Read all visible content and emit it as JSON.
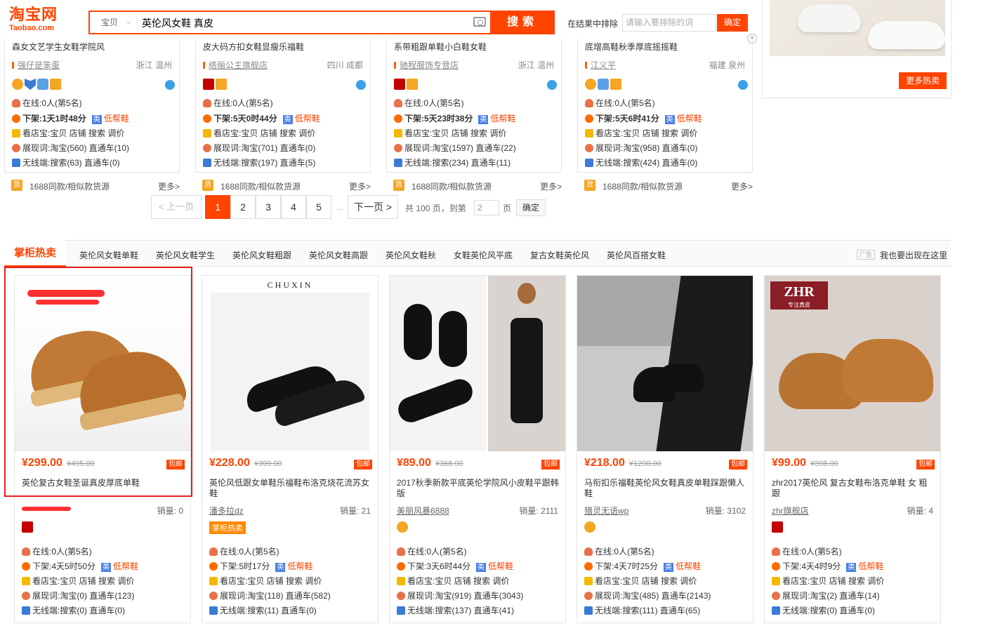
{
  "header": {
    "logo_cn": "淘宝网",
    "logo_en": "Taobao.com",
    "scope": "宝贝",
    "query": "英伦风女鞋 真皮",
    "search_btn": "搜索",
    "exclude_label": "在结果中排除",
    "exclude_placeholder": "请输入要排除的词",
    "exclude_btn": "确定",
    "close": "×"
  },
  "right_panel": {
    "more_btn": "更多热卖"
  },
  "top_cards": [
    {
      "title": "森女文艺学生女鞋学院风",
      "shop": "强仔是笨蛋",
      "loc": "浙江 温州",
      "online": "在线:0人(第5名)",
      "xiajia": "下架:1天1时48分",
      "lei": "类",
      "leilabel": "低帮鞋",
      "kdb": "看店宝:宝贝 店铺 搜索 调价",
      "zxc": "展现词:淘宝(560) 直通车(10)",
      "wx": "无线端:搜索(63) 直通车(0)",
      "r1688": "1688同款/相似款货源",
      "more": "更多>"
    },
    {
      "title": "皮大码方扣女鞋显瘦乐福鞋",
      "shop": "络俪公主旗舰店",
      "loc": "四川 成都",
      "online": "在线:0人(第5名)",
      "xiajia": "下架:5天0时44分",
      "lei": "类",
      "leilabel": "低帮鞋",
      "kdb": "看店宝:宝贝 店铺 搜索 调价",
      "zxc": "展现词:淘宝(701) 直通车(0)",
      "wx": "无线端:搜索(197) 直通车(5)",
      "r1688": "1688同款/相似款货源",
      "more": "更多>"
    },
    {
      "title": "系带粗跟单鞋小白鞋女鞋",
      "shop": "驰程服饰专营店",
      "loc": "浙江 温州",
      "online": "在线:0人(第5名)",
      "xiajia": "下架:5天23时38分",
      "lei": "类",
      "leilabel": "低帮鞋",
      "kdb": "看店宝:宝贝 店铺 搜索 调价",
      "zxc": "展现词:淘宝(1597) 直通车(22)",
      "wx": "无线端:搜索(234) 直通车(11)",
      "r1688": "1688同款/相似款货源",
      "more": "更多>"
    },
    {
      "title": "底增高鞋秋季厚底摇摇鞋",
      "shop": "江义平",
      "loc": "福建 泉州",
      "online": "在线:0人(第5名)",
      "xiajia": "下架:5天6时41分",
      "lei": "类",
      "leilabel": "低帮鞋",
      "kdb": "看店宝:宝贝 店铺 搜索 调价",
      "zxc": "展现词:淘宝(958) 直通车(0)",
      "wx": "无线端:搜索(424) 直通车(0)",
      "r1688": "1688同款/相似款货源",
      "more": "更多>"
    }
  ],
  "pager": {
    "prev": "< 上一页",
    "pages": [
      "1",
      "2",
      "3",
      "4",
      "5"
    ],
    "ellipsis": "...",
    "next": "下一页 >",
    "total": "共 100 页，到第",
    "goto": "2",
    "ye": "页",
    "ok": "确定"
  },
  "hot": {
    "title": "掌柜热卖",
    "links": [
      "英伦风女鞋单鞋",
      "英伦风女鞋学生",
      "英伦风女鞋粗跟",
      "英伦风女鞋高跟",
      "英伦风女鞋秋",
      "女鞋英伦风平底",
      "复古女鞋英伦风",
      "英伦风百搭女鞋"
    ],
    "ad": "广告",
    "ad_text": "我也要出现在这里"
  },
  "products": [
    {
      "price": "¥299.00",
      "oprice": "¥495.00",
      "baoyou": "包邮",
      "title": "英伦复古女鞋圣诞真皮厚底单鞋",
      "shop": "",
      "sales": "销量: 0",
      "badge": "",
      "online": "在线:0人(第5名)",
      "xiajia": "下架:4天5时50分",
      "lei": "类",
      "leilabel": "低帮鞋",
      "kdb": "看店宝:宝贝 店铺 搜索 调价",
      "zxc": "展现词:淘宝(0) 直通车(123)",
      "wx": "无线端:搜索(0) 直通车(0)"
    },
    {
      "price": "¥228.00",
      "oprice": "¥399.00",
      "baoyou": "包邮",
      "title": "英伦风低跟女单鞋乐福鞋布洛克烧花流苏女鞋",
      "shop": "潘多拉dz",
      "sales": "销量: 21",
      "badge": "掌柜热卖",
      "brand": "CHUXIN",
      "online": "在线:0人(第5名)",
      "xiajia": "下架:5时17分",
      "lei": "类",
      "leilabel": "低帮鞋",
      "kdb": "看店宝:宝贝 店铺 搜索 调价",
      "zxc": "展现词:淘宝(118) 直通车(582)",
      "wx": "无线端:搜索(11) 直通车(0)"
    },
    {
      "price": "¥89.00",
      "oprice": "¥368.00",
      "baoyou": "包邮",
      "title": "2017秋季新款平底英伦学院风小皮鞋平跟韩版",
      "shop": "美丽风暴6888",
      "sales": "销量: 2111",
      "badge": "",
      "online": "在线:0人(第5名)",
      "xiajia": "下架:3天6时44分",
      "lei": "类",
      "leilabel": "低帮鞋",
      "kdb": "看店宝:宝贝 店铺 搜索 调价",
      "zxc": "展现词:淘宝(919) 直通车(3043)",
      "wx": "无线端:搜索(137) 直通车(41)"
    },
    {
      "price": "¥218.00",
      "oprice": "¥1200.00",
      "baoyou": "包邮",
      "title": "马衔扣乐福鞋英伦风女鞋真皮单鞋踩跟懒人鞋",
      "shop": "猎灵无语wp",
      "sales": "销量: 3102",
      "badge": "",
      "online": "在线:0人(第5名)",
      "xiajia": "下架:4天7时25分",
      "lei": "类",
      "leilabel": "低帮鞋",
      "kdb": "看店宝:宝贝 店铺 搜索 调价",
      "zxc": "展现词:淘宝(485) 直通车(2143)",
      "wx": "无线端:搜索(111) 直通车(65)"
    },
    {
      "price": "¥99.00",
      "oprice": "¥398.00",
      "baoyou": "包邮",
      "title": "zhr2017英伦风 复古女鞋布洛克单鞋 女 粗跟",
      "shop": "zhr旗舰店",
      "sales": "销量: 4",
      "badge": "",
      "brand": "ZHR",
      "brand_sub": "专注真皮",
      "online": "在线:0人(第5名)",
      "xiajia": "下架:4天4时9分",
      "lei": "类",
      "leilabel": "低帮鞋",
      "kdb": "看店宝:宝贝 店铺 搜索 调价",
      "zxc": "展现词:淘宝(2) 直通车(14)",
      "wx": "无线端:搜索(0) 直通车(0)"
    }
  ]
}
